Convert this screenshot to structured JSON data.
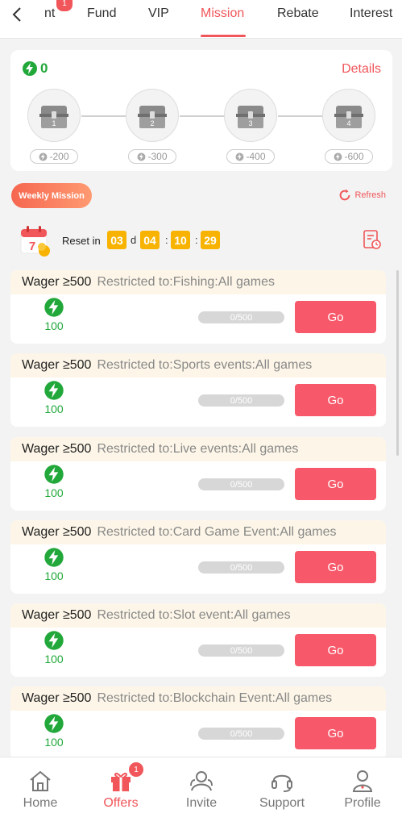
{
  "tabs": [
    {
      "label": "nt",
      "badge": "1"
    },
    {
      "label": "Fund"
    },
    {
      "label": "VIP"
    },
    {
      "label": "Mission",
      "active": true
    },
    {
      "label": "Rebate"
    },
    {
      "label": "Interest"
    }
  ],
  "points": {
    "value": "0",
    "details_label": "Details"
  },
  "chests": [
    {
      "number": "1",
      "requirement": "-200"
    },
    {
      "number": "2",
      "requirement": "-300"
    },
    {
      "number": "3",
      "requirement": "-400"
    },
    {
      "number": "4",
      "requirement": "-600"
    }
  ],
  "weekly": {
    "label": "Weekly Mission",
    "refresh_label": "Refresh"
  },
  "reset": {
    "calendar_day": "7",
    "label": "Reset in",
    "days": "03",
    "day_unit": "d",
    "hours": "04",
    "minutes": "10",
    "seconds": "29",
    "sep": ":"
  },
  "missions": [
    {
      "title": "Wager ≥500",
      "restriction": "Restricted to:Fishing:All games",
      "reward": "100",
      "progress": "0/500",
      "progress_fraction": 0,
      "action": "Go"
    },
    {
      "title": "Wager ≥500",
      "restriction": "Restricted to:Sports events:All games",
      "reward": "100",
      "progress": "0/500",
      "progress_fraction": 0,
      "action": "Go"
    },
    {
      "title": "Wager ≥500",
      "restriction": "Restricted to:Live events:All games",
      "reward": "100",
      "progress": "0/500",
      "progress_fraction": 0,
      "action": "Go"
    },
    {
      "title": "Wager ≥500",
      "restriction": "Restricted to:Card Game Event:All games",
      "reward": "100",
      "progress": "0/500",
      "progress_fraction": 0,
      "action": "Go"
    },
    {
      "title": "Wager ≥500",
      "restriction": "Restricted to:Slot event:All games",
      "reward": "100",
      "progress": "0/500",
      "progress_fraction": 0,
      "action": "Go"
    },
    {
      "title": "Wager ≥500",
      "restriction": "Restricted to:Blockchain Event:All games",
      "reward": "100",
      "progress": "0/500",
      "progress_fraction": 0,
      "action": "Go"
    }
  ],
  "nav": [
    {
      "label": "Home",
      "icon": "home-icon"
    },
    {
      "label": "Offers",
      "icon": "gift-icon",
      "active": true,
      "badge": "1"
    },
    {
      "label": "Invite",
      "icon": "invite-icon"
    },
    {
      "label": "Support",
      "icon": "headset-icon"
    },
    {
      "label": "Profile",
      "icon": "person-icon"
    }
  ],
  "colors": {
    "accent": "#f0565a",
    "points_green": "#22a83a",
    "timer_yellow": "#f7b300",
    "go_button": "#f7596a"
  }
}
